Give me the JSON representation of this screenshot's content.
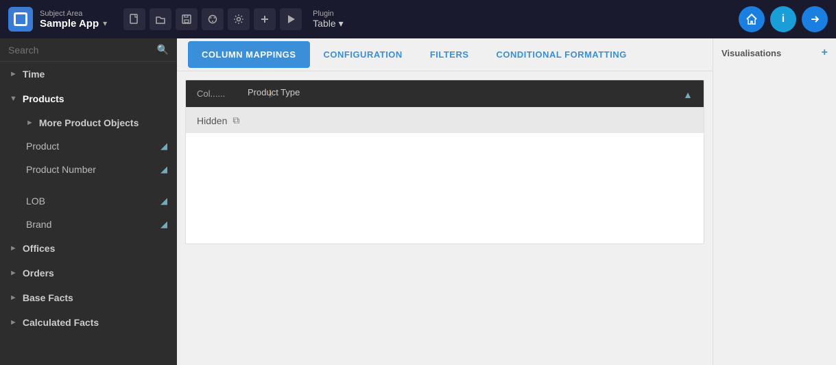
{
  "topbar": {
    "subject_area_label": "Subject Area",
    "app_name": "Sample App",
    "plugin_label": "Plugin",
    "plugin_name": "Table",
    "icons": [
      "new-icon",
      "open-icon",
      "save-icon",
      "palette-icon",
      "settings-icon",
      "add-icon",
      "play-icon"
    ]
  },
  "sidebar": {
    "search_placeholder": "Search",
    "items": [
      {
        "label": "Time",
        "type": "collapsed",
        "depth": 0
      },
      {
        "label": "Products",
        "type": "expanded",
        "depth": 0
      },
      {
        "label": "More Product Objects",
        "type": "collapsed",
        "depth": 1
      },
      {
        "label": "Product",
        "type": "leaf",
        "depth": 1,
        "has_filter": true
      },
      {
        "label": "Product Number",
        "type": "leaf",
        "depth": 1,
        "has_filter": true
      },
      {
        "label": "LOB",
        "type": "leaf",
        "depth": 1,
        "has_filter": true
      },
      {
        "label": "Brand",
        "type": "leaf",
        "depth": 1,
        "has_filter": true
      },
      {
        "label": "Offices",
        "type": "collapsed",
        "depth": 0
      },
      {
        "label": "Orders",
        "type": "collapsed",
        "depth": 0
      },
      {
        "label": "Base Facts",
        "type": "collapsed",
        "depth": 0
      },
      {
        "label": "Calculated Facts",
        "type": "collapsed",
        "depth": 0
      }
    ]
  },
  "tabs": [
    {
      "label": "COLUMN MAPPINGS",
      "active": true
    },
    {
      "label": "CONFIGURATION",
      "active": false
    },
    {
      "label": "FILTERS",
      "active": false
    },
    {
      "label": "CONDITIONAL FORMATTING",
      "active": false
    }
  ],
  "mapping": {
    "header_col": "Col......",
    "header_type": "Product Type",
    "filter_icon": "▼",
    "hidden_label": "Hidden",
    "copy_label": "⧉"
  },
  "right_panel": {
    "visualisations_label": "Visualisations",
    "add_label": "+"
  }
}
